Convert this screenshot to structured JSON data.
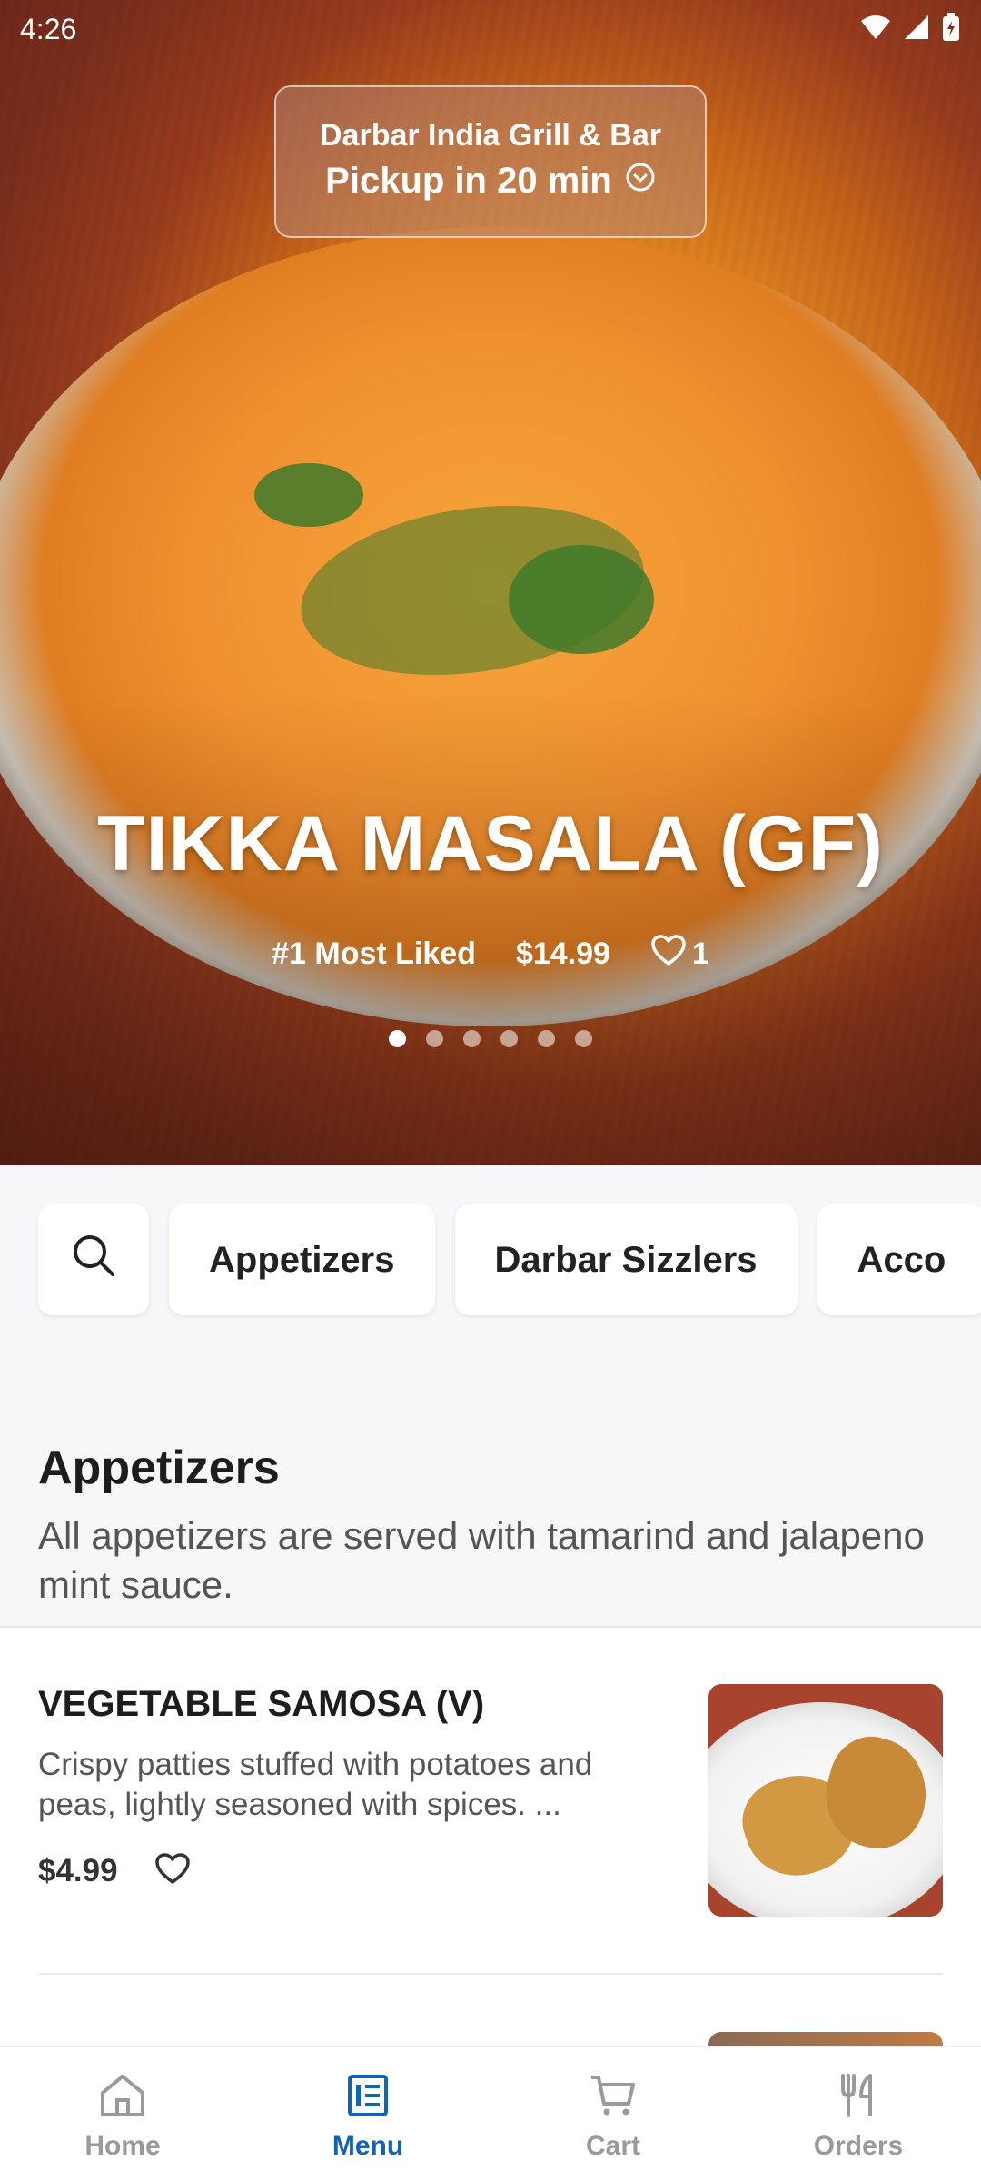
{
  "status_bar": {
    "time": "4:26"
  },
  "pickup": {
    "restaurant": "Darbar India Grill & Bar",
    "time_text": "Pickup in 20 min"
  },
  "featured": {
    "title": "TIKKA MASALA (GF)",
    "rank_text": "#1 Most Liked",
    "price": "$14.99",
    "likes": "1",
    "carousel_count": 6,
    "carousel_active_index": 0
  },
  "categories": [
    "Appetizers",
    "Darbar Sizzlers",
    "Acco"
  ],
  "section": {
    "title": "Appetizers",
    "description": "All appetizers are served with tamarind and jalapeno mint sauce."
  },
  "items": [
    {
      "name": "VEGETABLE SAMOSA (V)",
      "description": "Crispy patties stuffed with potatoes and peas, lightly seasoned with spices. ...",
      "price": "$4.99"
    }
  ],
  "bottom_nav": [
    {
      "label": "Home",
      "icon": "home-icon"
    },
    {
      "label": "Menu",
      "icon": "menu-icon",
      "active": true
    },
    {
      "label": "Cart",
      "icon": "cart-icon"
    },
    {
      "label": "Orders",
      "icon": "utensils-icon"
    }
  ],
  "colors": {
    "accent": "#1264b0",
    "inactive": "#9a9a9a",
    "background": "#f7f6f8"
  }
}
